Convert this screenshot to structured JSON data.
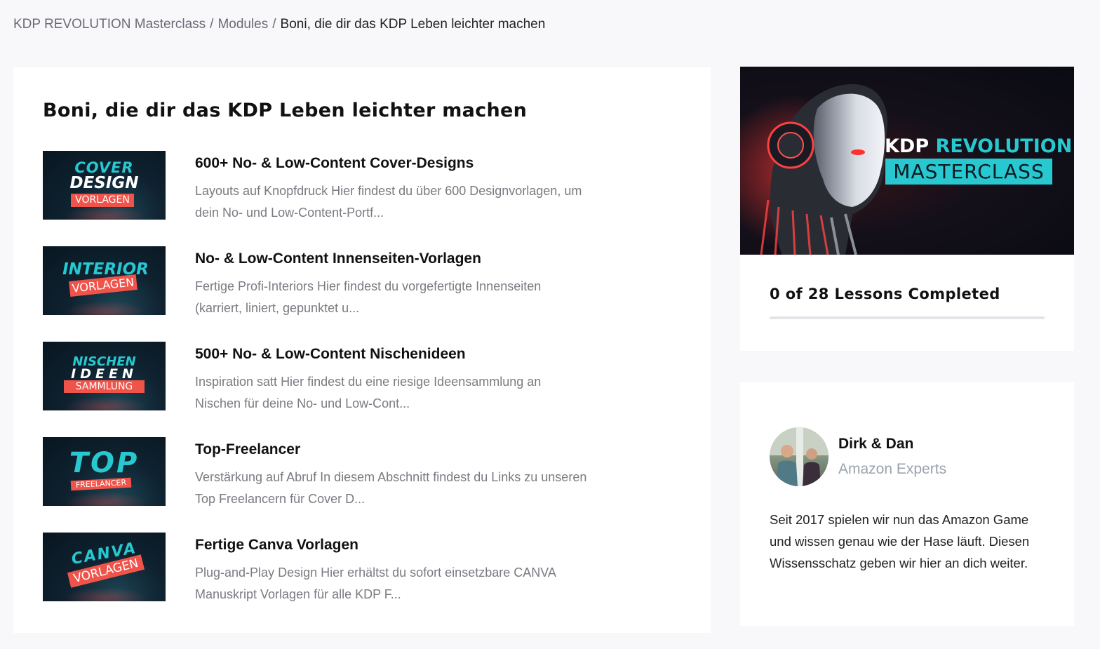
{
  "breadcrumb": {
    "course": "KDP REVOLUTION Masterclass",
    "modules": "Modules",
    "current": "Boni, die dir das KDP Leben leichter machen",
    "separator": "/"
  },
  "module": {
    "title": "Boni, die dir das KDP Leben leichter machen",
    "lessons": [
      {
        "title": "600+ No- & Low-Content Cover-Designs",
        "description": "Layouts auf Knopfdruck Hier findest du über 600 Designvorlagen, um dein No- und Low-Content-Portf...",
        "thumb_line1": "COVER",
        "thumb_line2": "DESIGN",
        "thumb_tag": "VORLAGEN"
      },
      {
        "title": "No- & Low-Content Innenseiten-Vorlagen",
        "description": "Fertige Profi-Interiors Hier findest du vorgefertigte Innenseiten (karriert, liniert, gepunktet u...",
        "thumb_line1": "INTERIOR",
        "thumb_tag": "VORLAGEN"
      },
      {
        "title": "500+ No- & Low-Content Nischenideen",
        "description": "Inspiration satt Hier findest du eine riesige Ideensammlung an Nischen für deine No- und Low-Cont...",
        "thumb_line1": "NISCHEN",
        "thumb_line2": "IDEEN",
        "thumb_tag": "SAMMLUNG"
      },
      {
        "title": "Top-Freelancer",
        "description": "Verstärkung auf Abruf In diesem Abschnitt findest du Links zu unseren Top Freelancern für Cover D...",
        "thumb_line1": "TOP",
        "thumb_tag": "FREELANCER"
      },
      {
        "title": "Fertige Canva Vorlagen",
        "description": "Plug-and-Play Design Hier erhältst du sofort einsetzbare CANVA Manuskript Vorlagen für alle KDP F...",
        "thumb_line1": "CANVA",
        "thumb_tag": "VORLAGEN"
      }
    ]
  },
  "course_card": {
    "hero_word1": "KDP",
    "hero_word2": "REVOLUTION",
    "hero_word3": "MASTERCLASS",
    "progress_label": "0 of 28 Lessons Completed",
    "lessons_completed": 0,
    "lessons_total": 28
  },
  "author": {
    "name": "Dirk & Dan",
    "role": "Amazon Experts",
    "bio": "Seit 2017 spielen wir nun das Amazon Game und wissen genau wie der Hase läuft. Diesen Wissensschatz geben wir hier an dich weiter."
  },
  "colors": {
    "accent": "#27c8d0",
    "tag_red": "#f0534a",
    "background": "#f8f8fb"
  }
}
